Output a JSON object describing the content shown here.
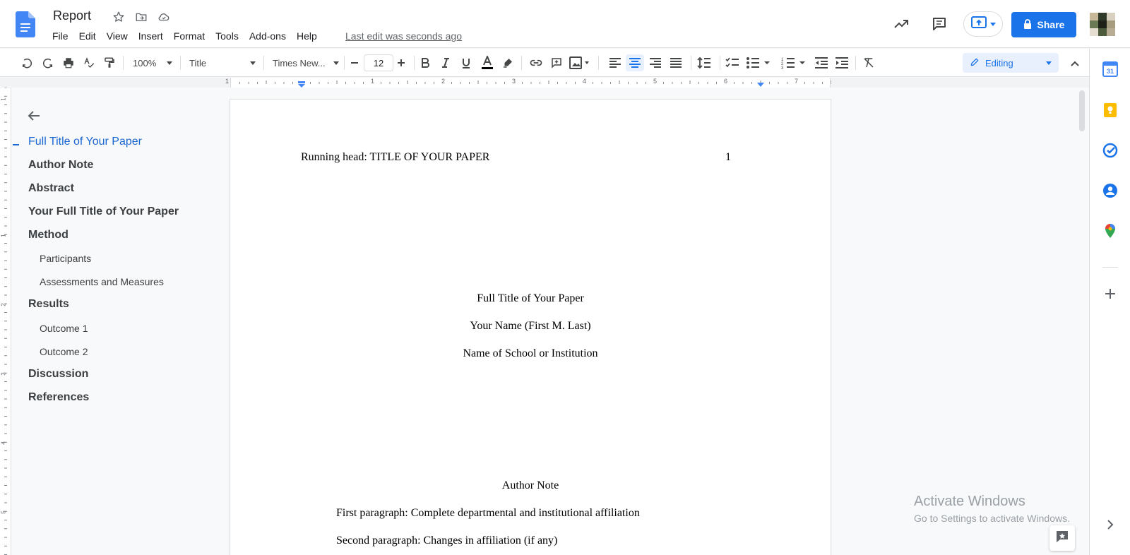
{
  "doc": {
    "title": "Report"
  },
  "menu": [
    "File",
    "Edit",
    "View",
    "Insert",
    "Format",
    "Tools",
    "Add-ons",
    "Help"
  ],
  "last_edit": "Last edit was seconds ago",
  "share_label": "Share",
  "toolbar": {
    "zoom": "100%",
    "style": "Title",
    "font": "Times New...",
    "font_size": "12",
    "mode": "Editing"
  },
  "ruler": {
    "h_labels": [
      "1",
      "1",
      "2",
      "3",
      "4",
      "5",
      "6",
      "7"
    ],
    "v_labels": [
      "1",
      "1",
      "2",
      "3",
      "4",
      "5"
    ]
  },
  "outline": [
    {
      "label": "Full Title of Your Paper",
      "level": 1,
      "active": true
    },
    {
      "label": "Author Note",
      "level": 1
    },
    {
      "label": "Abstract",
      "level": 1
    },
    {
      "label": "Your Full Title of Your Paper",
      "level": 1
    },
    {
      "label": "Method",
      "level": 1
    },
    {
      "label": "Participants",
      "level": 2
    },
    {
      "label": "Assessments and Measures",
      "level": 2
    },
    {
      "label": "Results",
      "level": 1
    },
    {
      "label": "Outcome 1",
      "level": 2
    },
    {
      "label": "Outcome 2",
      "level": 2
    },
    {
      "label": "Discussion",
      "level": 1
    },
    {
      "label": "References",
      "level": 1
    }
  ],
  "page": {
    "running_head": "Running head: TITLE OF YOUR PAPER",
    "page_number": "1",
    "title": "Full Title of Your Paper",
    "author": "Your Name (First M. Last)",
    "institution": "Name of School or Institution",
    "author_note_heading": "Author Note",
    "para1": "First paragraph: Complete departmental and institutional affiliation",
    "para2": "Second paragraph: Changes in affiliation (if any)"
  },
  "watermark": {
    "line1": "Activate Windows",
    "line2": "Go to Settings to activate Windows."
  },
  "colors": {
    "accent": "#1a73e8",
    "outline_active": "#1967d2"
  }
}
